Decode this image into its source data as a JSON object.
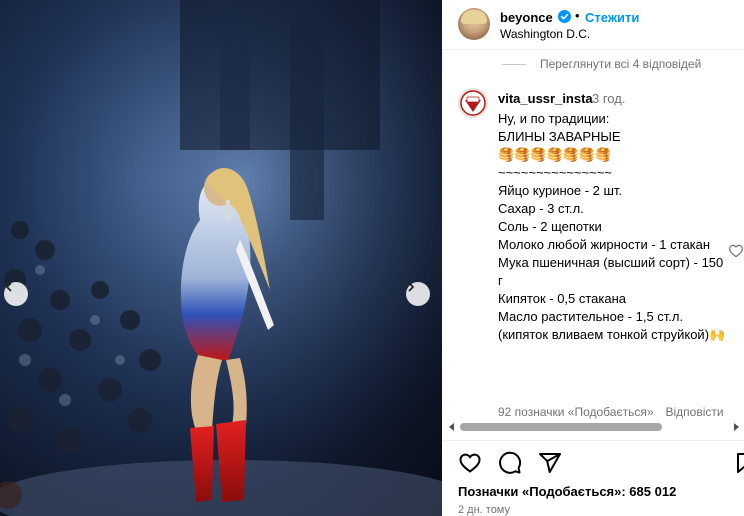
{
  "post_header": {
    "username": "beyonce",
    "follow_label": "Стежити",
    "separator": "•",
    "location": "Washington D.C."
  },
  "comments": {
    "view_replies_label": "Переглянути всі 4 відповідей",
    "comment": {
      "username": "vita_ussr_insta",
      "time": "3 год.",
      "lines": [
        "Ну, и по традиции:",
        "",
        "БЛИНЫ ЗАВАРНЫЕ",
        "🥞🥞🥞🥞🥞🥞🥞",
        "~~~~~~~~~~~~~~~",
        "Яйцо куриное - 2 шт.",
        "Сахар - 3 ст.л.",
        "Соль - 2 щепотки",
        "Молоко любой жирности - 1 стакан",
        "Мука пшеничная (высший сорт) - 150 г",
        "Кипяток - 0,5 стакана",
        "Масло растительное - 1,5 ст.л.",
        "(кипяток вливаем тонкой струйкой)🙌"
      ],
      "likes_label": "92 позначки «Подобається»",
      "reply_label": "Відповісти"
    }
  },
  "post_footer": {
    "likes_text": "Позначки «Подобається»: 685 012",
    "posted_ago": "2 дн. тому"
  },
  "icons": {
    "verified": "verified-badge-icon",
    "like": "heart-icon",
    "comment": "comment-icon",
    "share": "share-icon",
    "save": "bookmark-icon"
  },
  "colors": {
    "accent": "#0095f6",
    "secondary_text": "#737373"
  }
}
